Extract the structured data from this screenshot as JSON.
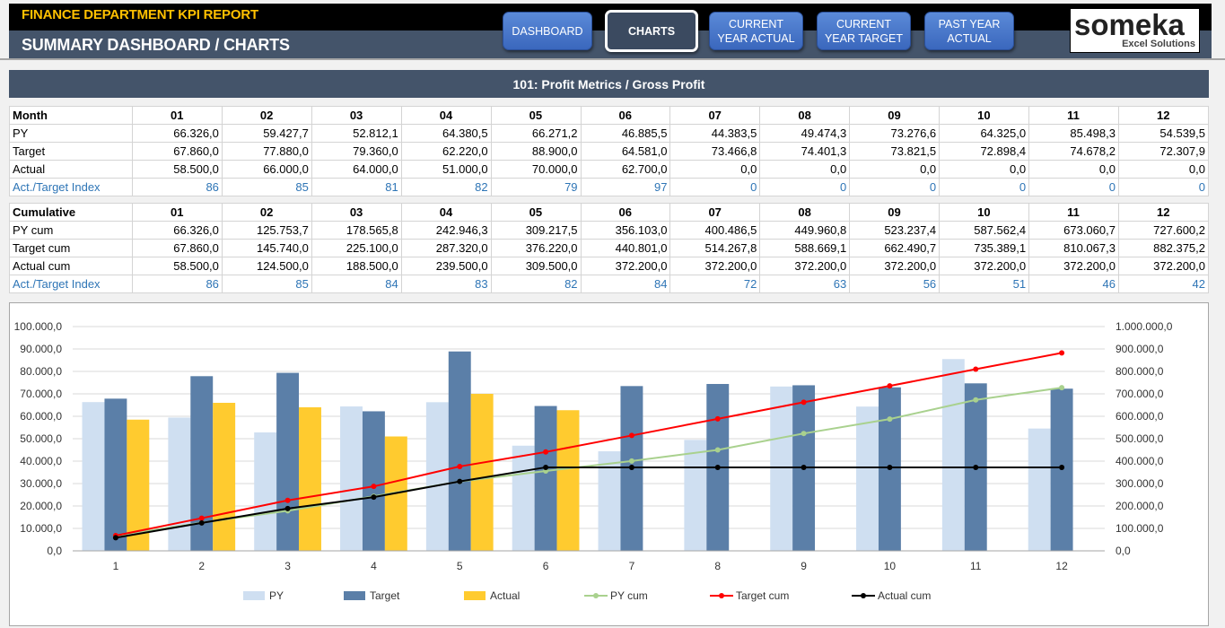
{
  "header": {
    "app_title": "FINANCE DEPARTMENT KPI REPORT",
    "page_title": "SUMMARY DASHBOARD / CHARTS",
    "nav": [
      {
        "label": "DASHBOARD",
        "active": false
      },
      {
        "label": "CHARTS",
        "active": true
      },
      {
        "label": "CURRENT YEAR ACTUAL",
        "active": false
      },
      {
        "label": "CURRENT YEAR TARGET",
        "active": false
      },
      {
        "label": "PAST YEAR ACTUAL",
        "active": false
      }
    ],
    "logo": {
      "word": "someka",
      "sub": "Excel Solutions"
    }
  },
  "section_title": "101: Profit Metrics / Gross Profit",
  "monthly_table": {
    "header": "Month",
    "months": [
      "01",
      "02",
      "03",
      "04",
      "05",
      "06",
      "07",
      "08",
      "09",
      "10",
      "11",
      "12"
    ],
    "rows": [
      {
        "label": "PY",
        "values": [
          "66.326,0",
          "59.427,7",
          "52.812,1",
          "64.380,5",
          "66.271,2",
          "46.885,5",
          "44.383,5",
          "49.474,3",
          "73.276,6",
          "64.325,0",
          "85.498,3",
          "54.539,5"
        ]
      },
      {
        "label": "Target",
        "values": [
          "67.860,0",
          "77.880,0",
          "79.360,0",
          "62.220,0",
          "88.900,0",
          "64.581,0",
          "73.466,8",
          "74.401,3",
          "73.821,5",
          "72.898,4",
          "74.678,2",
          "72.307,9"
        ]
      },
      {
        "label": "Actual",
        "values": [
          "58.500,0",
          "66.000,0",
          "64.000,0",
          "51.000,0",
          "70.000,0",
          "62.700,0",
          "0,0",
          "0,0",
          "0,0",
          "0,0",
          "0,0",
          "0,0"
        ]
      },
      {
        "label": "Act./Target Index",
        "values": [
          "86",
          "85",
          "81",
          "82",
          "79",
          "97",
          "0",
          "0",
          "0",
          "0",
          "0",
          "0"
        ],
        "index": true
      }
    ]
  },
  "cumulative_table": {
    "header": "Cumulative",
    "months": [
      "01",
      "02",
      "03",
      "04",
      "05",
      "06",
      "07",
      "08",
      "09",
      "10",
      "11",
      "12"
    ],
    "rows": [
      {
        "label": "PY cum",
        "values": [
          "66.326,0",
          "125.753,7",
          "178.565,8",
          "242.946,3",
          "309.217,5",
          "356.103,0",
          "400.486,5",
          "449.960,8",
          "523.237,4",
          "587.562,4",
          "673.060,7",
          "727.600,2"
        ]
      },
      {
        "label": "Target cum",
        "values": [
          "67.860,0",
          "145.740,0",
          "225.100,0",
          "287.320,0",
          "376.220,0",
          "440.801,0",
          "514.267,8",
          "588.669,1",
          "662.490,7",
          "735.389,1",
          "810.067,3",
          "882.375,2"
        ]
      },
      {
        "label": "Actual cum",
        "values": [
          "58.500,0",
          "124.500,0",
          "188.500,0",
          "239.500,0",
          "309.500,0",
          "372.200,0",
          "372.200,0",
          "372.200,0",
          "372.200,0",
          "372.200,0",
          "372.200,0",
          "372.200,0"
        ]
      },
      {
        "label": "Act./Target Index",
        "values": [
          "86",
          "85",
          "84",
          "83",
          "82",
          "84",
          "72",
          "63",
          "56",
          "51",
          "46",
          "42"
        ],
        "index": true
      }
    ]
  },
  "chart_data": {
    "type": "bar",
    "categories": [
      "1",
      "2",
      "3",
      "4",
      "5",
      "6",
      "7",
      "8",
      "9",
      "10",
      "11",
      "12"
    ],
    "series": [
      {
        "name": "PY",
        "kind": "bar",
        "axis": "left",
        "color": "#cfdff1",
        "values": [
          66326.0,
          59427.7,
          52812.1,
          64380.5,
          66271.2,
          46885.5,
          44383.5,
          49474.3,
          73276.6,
          64325.0,
          85498.3,
          54539.5
        ]
      },
      {
        "name": "Target",
        "kind": "bar",
        "axis": "left",
        "color": "#5b7fa8",
        "values": [
          67860.0,
          77880.0,
          79360.0,
          62220.0,
          88900.0,
          64581.0,
          73466.8,
          74401.3,
          73821.5,
          72898.4,
          74678.2,
          72307.9
        ]
      },
      {
        "name": "Actual",
        "kind": "bar",
        "axis": "left",
        "color": "#ffcb2f",
        "values": [
          58500.0,
          66000.0,
          64000.0,
          51000.0,
          70000.0,
          62700.0,
          0,
          0,
          0,
          0,
          0,
          0
        ]
      },
      {
        "name": "PY cum",
        "kind": "line",
        "axis": "right",
        "color": "#a9d18e",
        "values": [
          66326.0,
          125753.7,
          178565.8,
          242946.3,
          309217.5,
          356103.0,
          400486.5,
          449960.8,
          523237.4,
          587562.4,
          673060.7,
          727600.2
        ]
      },
      {
        "name": "Target cum",
        "kind": "line",
        "axis": "right",
        "color": "#ff0000",
        "values": [
          67860.0,
          145740.0,
          225100.0,
          287320.0,
          376220.0,
          440801.0,
          514267.8,
          588669.1,
          662490.7,
          735389.1,
          810067.3,
          882375.2
        ]
      },
      {
        "name": "Actual cum",
        "kind": "line",
        "axis": "right",
        "color": "#000000",
        "values": [
          58500.0,
          124500.0,
          188500.0,
          239500.0,
          309500.0,
          372200.0,
          372200.0,
          372200.0,
          372200.0,
          372200.0,
          372200.0,
          372200.0
        ]
      }
    ],
    "title": "",
    "xlabel": "",
    "ylabel": "",
    "ylim": [
      0,
      100000
    ],
    "y2lim": [
      0,
      1000000
    ],
    "y_ticks": [
      "0,0",
      "10.000,0",
      "20.000,0",
      "30.000,0",
      "40.000,0",
      "50.000,0",
      "60.000,0",
      "70.000,0",
      "80.000,0",
      "90.000,0",
      "100.000,0"
    ],
    "y2_ticks": [
      "0,0",
      "100.000,0",
      "200.000,0",
      "300.000,0",
      "400.000,0",
      "500.000,0",
      "600.000,0",
      "700.000,0",
      "800.000,0",
      "900.000,0",
      "1.000.000,0"
    ],
    "grid": true,
    "legend_position": "bottom"
  }
}
